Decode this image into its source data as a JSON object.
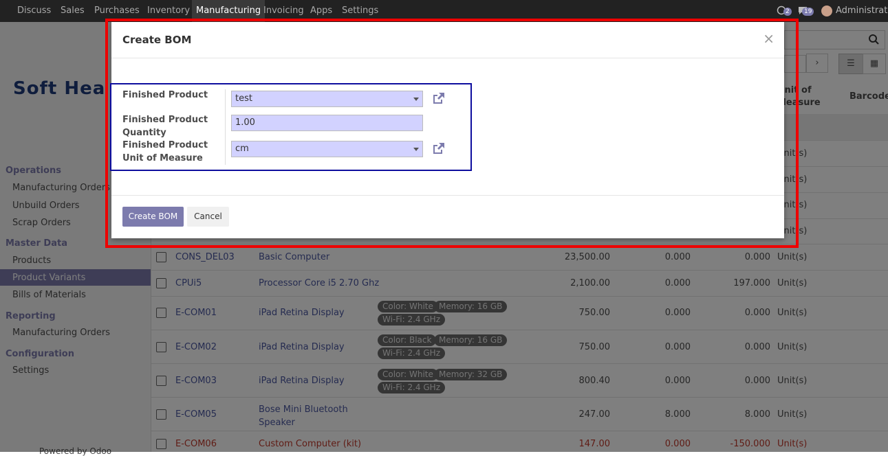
{
  "topnav": {
    "menus": [
      "Discuss",
      "Sales",
      "Purchases",
      "Inventory",
      "Manufacturing",
      "Invoicing",
      "Apps",
      "Settings"
    ],
    "active": "Manufacturing",
    "messages_count": "2",
    "activity_count": "19",
    "user": "Administrator"
  },
  "brand": {
    "logo_text": "Soft Hea"
  },
  "sidebar": {
    "sections": [
      {
        "title": "Operations",
        "items": [
          "Manufacturing Orders",
          "Unbuild Orders",
          "Scrap Orders"
        ]
      },
      {
        "title": "Master Data",
        "items": [
          "Products",
          "Product Variants",
          "Bills of Materials"
        ]
      },
      {
        "title": "Reporting",
        "items": [
          "Manufacturing Orders"
        ]
      },
      {
        "title": "Configuration",
        "items": [
          "Settings"
        ]
      }
    ],
    "selected": "Product Variants",
    "powered_by": "Powered by Odoo"
  },
  "list": {
    "headers": {
      "uom": "Unit of Measure",
      "barcode": "Barcode"
    },
    "rows": [
      {
        "ref": "CONS_DEL03",
        "name": "Basic Computer",
        "tags": [],
        "price": "23,500.00",
        "onhand": "0.000",
        "forecast": "0.000",
        "uom": "Unit(s)",
        "red": false
      },
      {
        "ref": "CPUi5",
        "name": "Processor Core i5 2.70 Ghz",
        "tags": [],
        "price": "2,100.00",
        "onhand": "0.000",
        "forecast": "197.000",
        "uom": "Unit(s)",
        "red": false
      },
      {
        "ref": "E-COM01",
        "name": "iPad Retina Display",
        "tags": [
          "Color: White",
          "Memory: 16 GB",
          "Wi-Fi: 2.4 GHz"
        ],
        "price": "750.00",
        "onhand": "0.000",
        "forecast": "0.000",
        "uom": "Unit(s)",
        "red": false
      },
      {
        "ref": "E-COM02",
        "name": "iPad Retina Display",
        "tags": [
          "Color: Black",
          "Memory: 16 GB",
          "Wi-Fi: 2.4 GHz"
        ],
        "price": "750.00",
        "onhand": "0.000",
        "forecast": "0.000",
        "uom": "Unit(s)",
        "red": false
      },
      {
        "ref": "E-COM03",
        "name": "iPad Retina Display",
        "tags": [
          "Color: White",
          "Memory: 32 GB",
          "Wi-Fi: 2.4 GHz"
        ],
        "price": "800.40",
        "onhand": "0.000",
        "forecast": "0.000",
        "uom": "Unit(s)",
        "red": false
      },
      {
        "ref": "E-COM05",
        "name": "Bose Mini Bluetooth Speaker",
        "tags": [],
        "price": "247.00",
        "onhand": "8.000",
        "forecast": "8.000",
        "uom": "Unit(s)",
        "red": false
      },
      {
        "ref": "E-COM06",
        "name": "Custom Computer (kit)",
        "tags": [],
        "price": "147.00",
        "onhand": "0.000",
        "forecast": "-150.000",
        "uom": "Unit(s)",
        "red": true
      }
    ],
    "behind_modal_uom": [
      "Unit(s)",
      "Unit(s)",
      "Unit(s)",
      "Unit(s)"
    ]
  },
  "modal": {
    "title": "Create BOM",
    "close": "×",
    "fields": {
      "finished_product_label": "Finished Product",
      "finished_product_value": "test",
      "qty_label_1": "Finished Product",
      "qty_label_2": "Quantity",
      "qty_value": "1.00",
      "uom_label_1": "Finished Product",
      "uom_label_2": "Unit of Measure",
      "uom_value": "cm"
    },
    "buttons": {
      "create": "Create BOM",
      "cancel": "Cancel"
    }
  },
  "colors": {
    "accent": "#7c7bad",
    "annotation_red": "#ee0000",
    "annotation_blue": "#0d0d9e"
  }
}
